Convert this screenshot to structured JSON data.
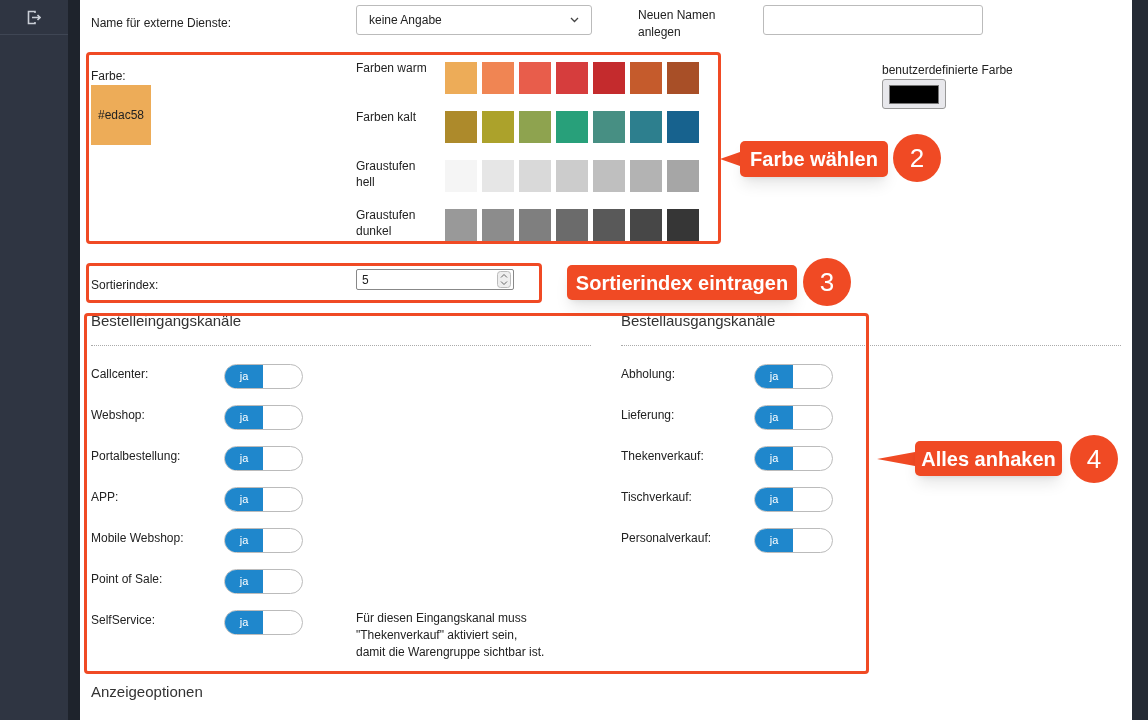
{
  "external_name": {
    "label": "Name für externe Dienste:",
    "select_value": "keine Angabe",
    "new_name_label": "Neuen Namen anlegen"
  },
  "color": {
    "label": "Farbe:",
    "value": "#edac58",
    "palettes": [
      {
        "label": "Farben warm",
        "swatches": [
          {
            "color": "#edac58"
          },
          {
            "color": "#f08553"
          },
          {
            "color": "#e85d4b"
          },
          {
            "color": "#d63d3d"
          },
          {
            "color": "#c42b2d"
          },
          {
            "color": "#c55b2c"
          },
          {
            "color": "#a84f27"
          }
        ]
      },
      {
        "label": "Farben kalt",
        "swatches": [
          {
            "color": "#ad8a2b"
          },
          {
            "color": "#aca22b"
          },
          {
            "color": "#8ea34f"
          },
          {
            "color": "#28a07a"
          },
          {
            "color": "#478f83"
          },
          {
            "color": "#2d7f8e"
          },
          {
            "color": "#17628e"
          }
        ]
      },
      {
        "label": "Graustufen hell",
        "swatches": [
          {
            "color": "#f5f5f5"
          },
          {
            "color": "#e6e6e6"
          },
          {
            "color": "#d9d9d9"
          },
          {
            "color": "#cccccc"
          },
          {
            "color": "#bfbfbf"
          },
          {
            "color": "#b3b3b3"
          },
          {
            "color": "#a6a6a6"
          }
        ]
      },
      {
        "label": "Graustufen dunkel",
        "swatches": [
          {
            "color": "#999999"
          },
          {
            "color": "#8c8c8c"
          },
          {
            "color": "#7f7f7f"
          },
          {
            "color": "#6b6b6b"
          },
          {
            "color": "#595959"
          },
          {
            "color": "#474747"
          },
          {
            "color": "#363636"
          }
        ]
      }
    ],
    "custom_label": "benutzerdefinierte Farbe",
    "custom_color": {
      "color": "#000000"
    }
  },
  "sort_index": {
    "label": "Sortierindex:",
    "value": "5"
  },
  "incoming": {
    "title": "Bestelleingangskanäle",
    "channels": [
      {
        "label": "Callcenter:",
        "on": true,
        "toggle_text": "ja"
      },
      {
        "label": "Webshop:",
        "on": true,
        "toggle_text": "ja"
      },
      {
        "label": "Portalbestellung:",
        "on": true,
        "toggle_text": "ja"
      },
      {
        "label": "APP:",
        "on": true,
        "toggle_text": "ja"
      },
      {
        "label": "Mobile Webshop:",
        "on": true,
        "toggle_text": "ja"
      },
      {
        "label": "Point of Sale:",
        "on": true,
        "toggle_text": "ja"
      },
      {
        "label": "SelfService:",
        "on": true,
        "toggle_text": "ja"
      }
    ],
    "note": "Für diesen Eingangskanal muss\n\"Thekenverkauf\" aktiviert sein,\ndamit die Warengruppe sichtbar ist."
  },
  "outgoing": {
    "title": "Bestellausgangskanäle",
    "channels": [
      {
        "label": "Abholung:",
        "on": true,
        "toggle_text": "ja"
      },
      {
        "label": "Lieferung:",
        "on": true,
        "toggle_text": "ja"
      },
      {
        "label": "Thekenverkauf:",
        "on": true,
        "toggle_text": "ja"
      },
      {
        "label": "Tischverkauf:",
        "on": true,
        "toggle_text": "ja"
      },
      {
        "label": "Personalverkauf:",
        "on": true,
        "toggle_text": "ja"
      }
    ]
  },
  "display_options_title": "Anzeigeoptionen",
  "annotations": [
    {
      "text": "Farbe wählen",
      "number": "2"
    },
    {
      "text": "Sortierindex eintragen",
      "number": "3"
    },
    {
      "text": "Alles anhaken",
      "number": "4"
    }
  ]
}
